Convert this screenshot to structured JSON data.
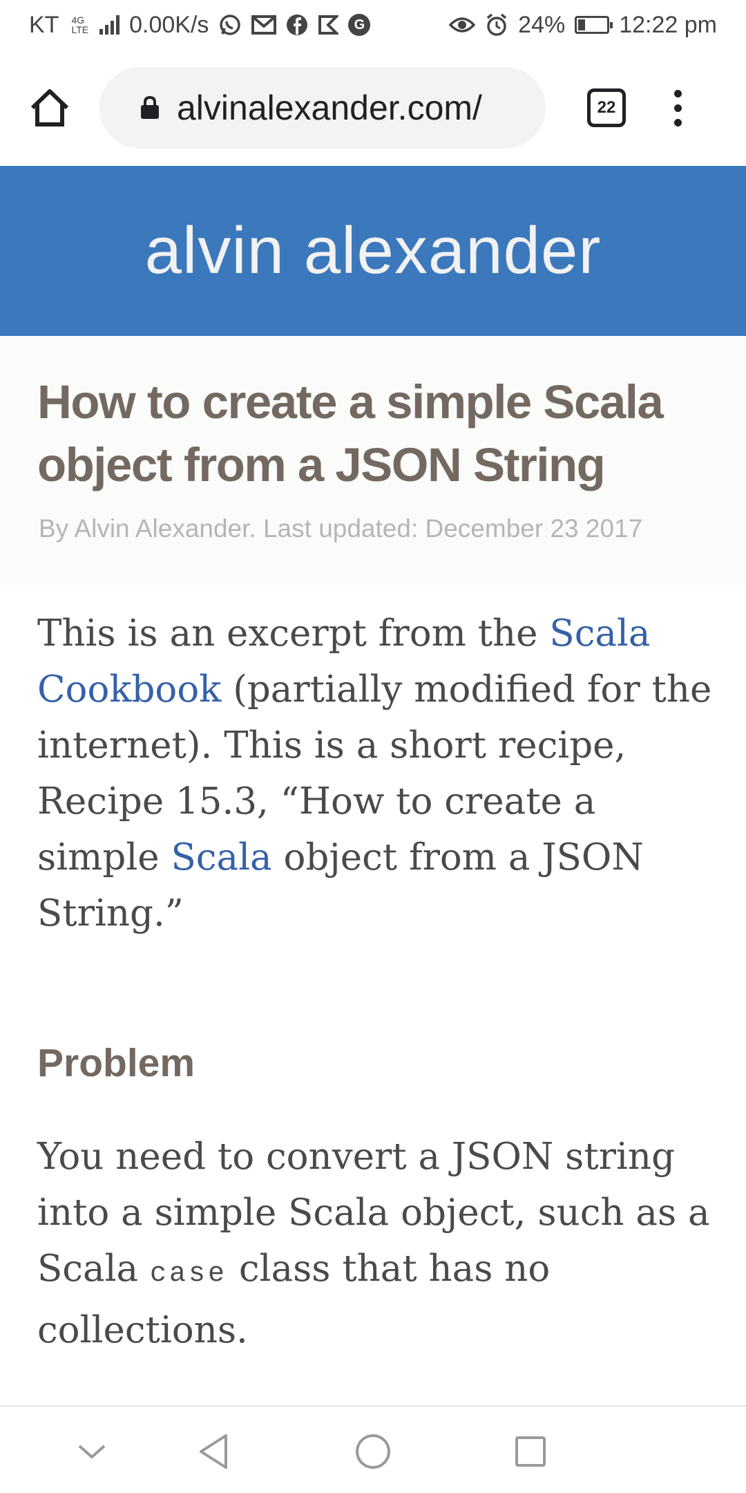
{
  "status_bar": {
    "carrier": "KT",
    "network_type_top": "4G",
    "network_type_bottom": "LTE",
    "speed": "0.00K/s",
    "notification_icons": [
      "whatsapp-icon",
      "gmail-icon",
      "facebook-icon",
      "flipboard-icon",
      "g-icon"
    ],
    "g_letter": "G",
    "battery": "24%",
    "battery_level": 0.24,
    "time": "12:22 pm"
  },
  "browser": {
    "url": "alvinalexander.com/",
    "tab_count": "22"
  },
  "site": {
    "title": "alvin alexander"
  },
  "article": {
    "title": "How to create a simple Scala object from a JSON String",
    "byline": "By Alvin Alexander. Last updated: December 23 2017",
    "intro": {
      "t1": "This is an excerpt from the ",
      "link1": "Scala Cookbook",
      "t2": " (partially modified for the internet). This is a short recipe, Recipe 15.3, “How to create a simple ",
      "link2": "Scala",
      "t3": " object from a JSON String.”"
    },
    "problem_heading": "Problem",
    "problem": {
      "t1": "You need to convert a JSON string into a simple Scala object, such as a Scala ",
      "code": "case",
      "t2": " class that has no collections."
    }
  },
  "colors": {
    "header_blue": "#3b78bc",
    "title_brown": "#746960",
    "link_blue": "#3561a8"
  }
}
